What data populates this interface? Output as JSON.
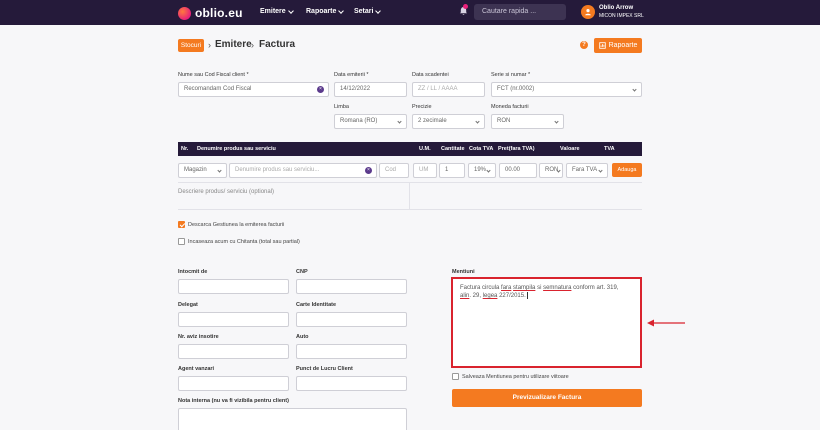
{
  "nav": {
    "logo": "oblio.eu",
    "items": [
      "Emitere",
      "Rapoarte",
      "Setari"
    ],
    "search_placeholder": "Cautare rapida ...",
    "user_initial": "O",
    "user_name": "Oblio Arrow",
    "user_company": "MICON IMPEX SRL"
  },
  "breadcrumb": {
    "stocuri": "Stocuri",
    "items": [
      "Emitere",
      "Factura"
    ],
    "help": "?",
    "rapoarte": "Rapoarte"
  },
  "form": {
    "client_label": "Nume sau Cod Fiscal client *",
    "client_placeholder": "Recomandam Cod Fiscal",
    "data_emiterii_label": "Data emiterii *",
    "data_emiterii": "14/12/2022",
    "data_scadentei_label": "Data scadentei",
    "data_scadentei_placeholder": "ZZ / LL / AAAA",
    "serie_label": "Serie si numar *",
    "serie": "FCT (nr.0002)",
    "limba_label": "Limba",
    "limba": "Romana (RO)",
    "precizie_label": "Precizie",
    "precizie": "2 zecimale",
    "moneda_label": "Moneda facturii",
    "moneda": "RON"
  },
  "products": {
    "headers": [
      "Nr.",
      "Denumire produs sau serviciu",
      "U.M.",
      "Cantitate",
      "Cota TVA",
      "Pret(fara TVA)",
      "Valoare",
      "TVA"
    ],
    "gestiune": "Magazin",
    "denumire_placeholder": "Denumire produs sau serviciu...",
    "cod_placeholder": "Cod",
    "um_placeholder": "UM",
    "cantitate": "1",
    "cota": "19%",
    "pret": "00.00",
    "moneda": "RON",
    "fara_tva": "Fara TVA",
    "adauga": "Adauga",
    "descriere_placeholder": "Descriere produs/ serviciu (optional)"
  },
  "options": {
    "descarca": "Descarca Gestiunea la emiterea facturii",
    "incasare": "Incaseaza acum cu Chitanta (total sau partial)"
  },
  "details": {
    "intocmit": "Intocmit de",
    "cnp": "CNP",
    "delegat": "Delegat",
    "carte": "Carte Identitate",
    "aviz": "Nr. aviz insotire",
    "auto": "Auto",
    "agent": "Agent vanzari",
    "punct": "Punct de Lucru Client",
    "nota": "Nota interna (nu va fi vizibila pentru client)"
  },
  "mentiuni": {
    "label": "Mentiuni",
    "text_1": "Factura circula",
    "text_fara": "fara",
    "text_stampila": "stampila",
    "text_si": "si",
    "text_semnatura": "semnatura",
    "text_2": "conform art. 319,",
    "text_alin": "alin",
    "text_3": ". 29,",
    "text_legea": "legea",
    "text_4": "227/2015.",
    "salveaza": "Salveaza Mentiunea pentru utilizare viitoare",
    "preview": "Previzualizare Factura"
  },
  "colors": {
    "brand_dark": "#251a3a",
    "accent": "#f47a20",
    "highlight": "#d9232e"
  }
}
